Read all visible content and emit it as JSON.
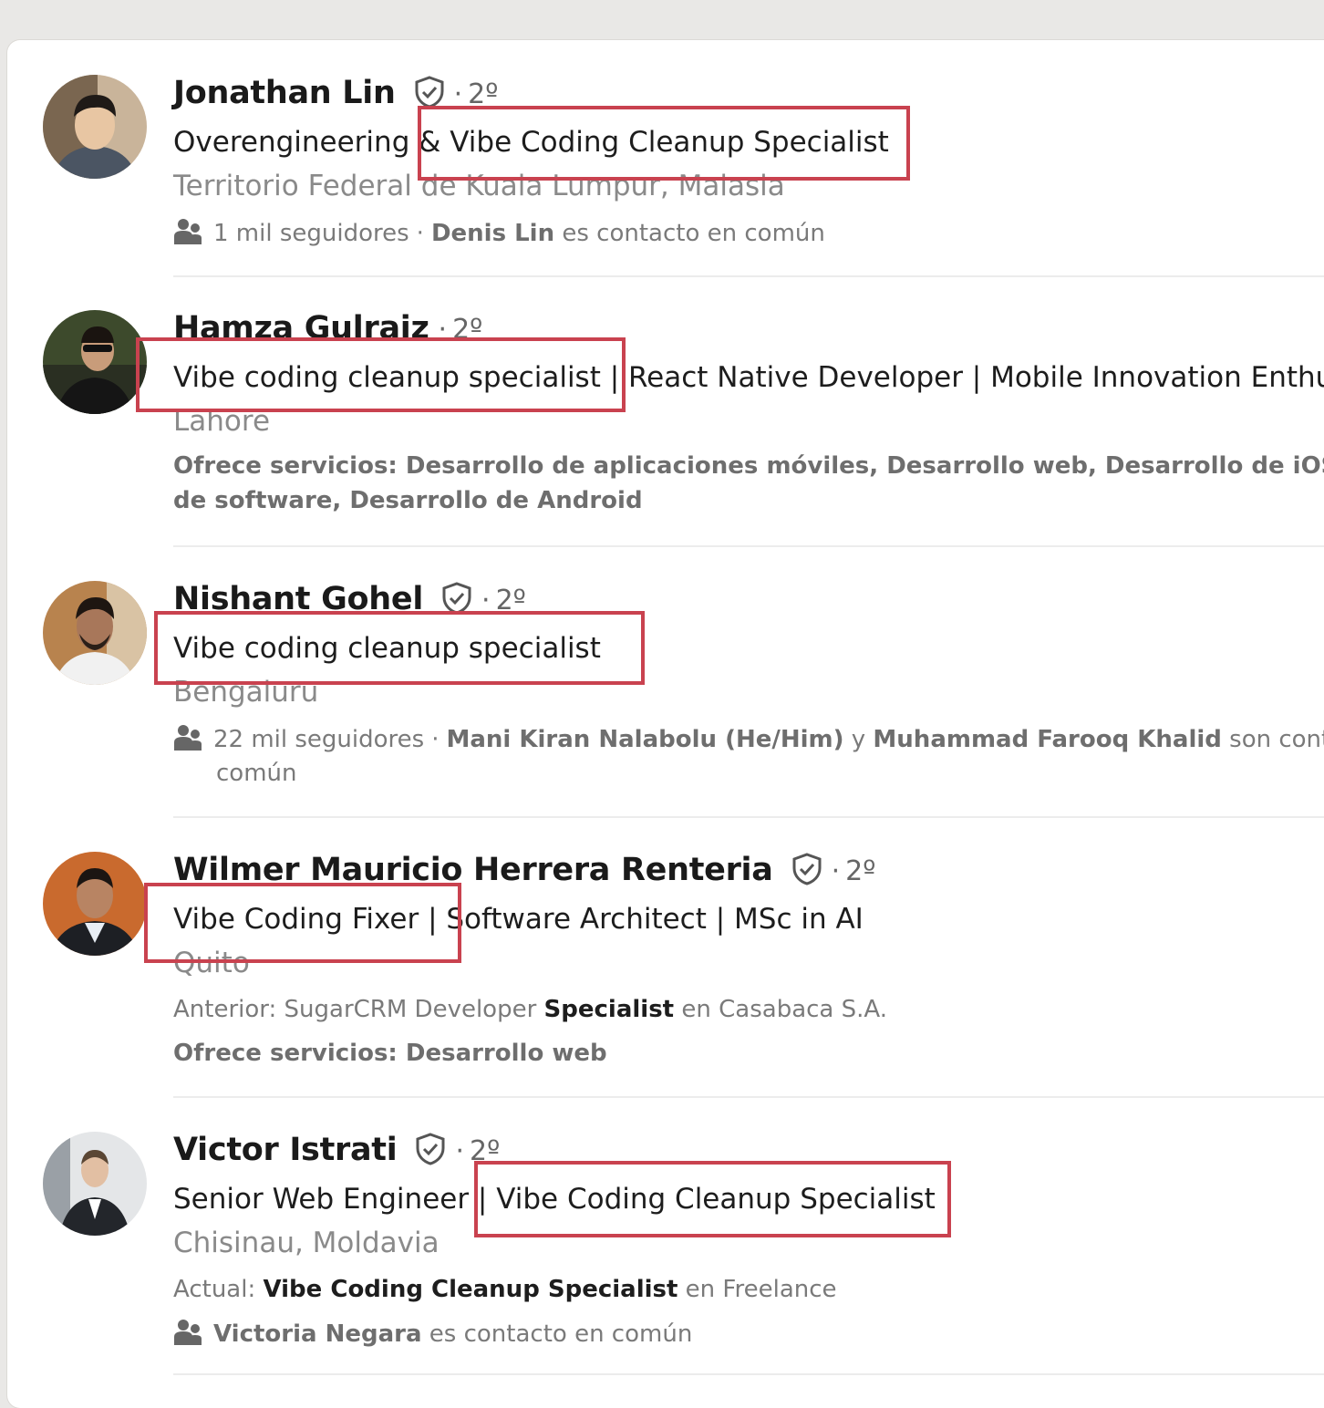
{
  "results": [
    {
      "name": "Jonathan Lin",
      "verified": true,
      "degree": "2º",
      "headline": "Overengineering & Vibe Coding Cleanup Specialist",
      "location": "Territorio Federal de Kuala Lumpur, Malasia",
      "followers": "1 mil seguidores",
      "mutual_name": "Denis Lin",
      "mutual_suffix": " es contacto en común"
    },
    {
      "name": "Hamza Gulraiz",
      "verified": false,
      "degree": "2º",
      "headline": "Vibe coding cleanup specialist | React Native Developer | Mobile Innovation Enthusi",
      "location": "Lahore",
      "services_line1": "Ofrece servicios: Desarrollo de aplicaciones móviles, Desarrollo web, Desarrollo de iOS, Pr",
      "services_line2": "de software, Desarrollo de Android"
    },
    {
      "name": "Nishant Gohel",
      "verified": true,
      "degree": "2º",
      "headline": "Vibe coding cleanup specialist",
      "location": "Bengaluru",
      "followers": "22 mil seguidores",
      "mutual_name_1": "Mani Kiran Nalabolu (He/Him)",
      "mutual_conj": " y ",
      "mutual_name_2": "Muhammad Farooq Khalid",
      "mutual_suffix": " son conta",
      "mutual_line2": "común"
    },
    {
      "name": "Wilmer Mauricio Herrera Renteria",
      "verified": true,
      "degree": "2º",
      "headline": "Vibe Coding Fixer | Software Architect | MSc in AI",
      "location": "Quito",
      "past_prefix": "Anterior: SugarCRM Developer ",
      "past_bold": "Specialist",
      "past_suffix": " en Casabaca S.A.",
      "services": "Ofrece servicios: Desarrollo web"
    },
    {
      "name": "Victor Istrati",
      "verified": true,
      "degree": "2º",
      "headline": "Senior Web Engineer | Vibe Coding Cleanup Specialist",
      "location": "Chisinau, Moldavia",
      "current_prefix": "Actual: ",
      "current_bold": "Vibe Coding Cleanup Specialist",
      "current_suffix": " en Freelance",
      "mutual_name": "Victoria Negara",
      "mutual_suffix": " es contacto en común"
    }
  ],
  "colors": {
    "highlight_box": "#c9424f",
    "secondary_text": "#8a8a8a",
    "background": "#e9e8e6"
  }
}
